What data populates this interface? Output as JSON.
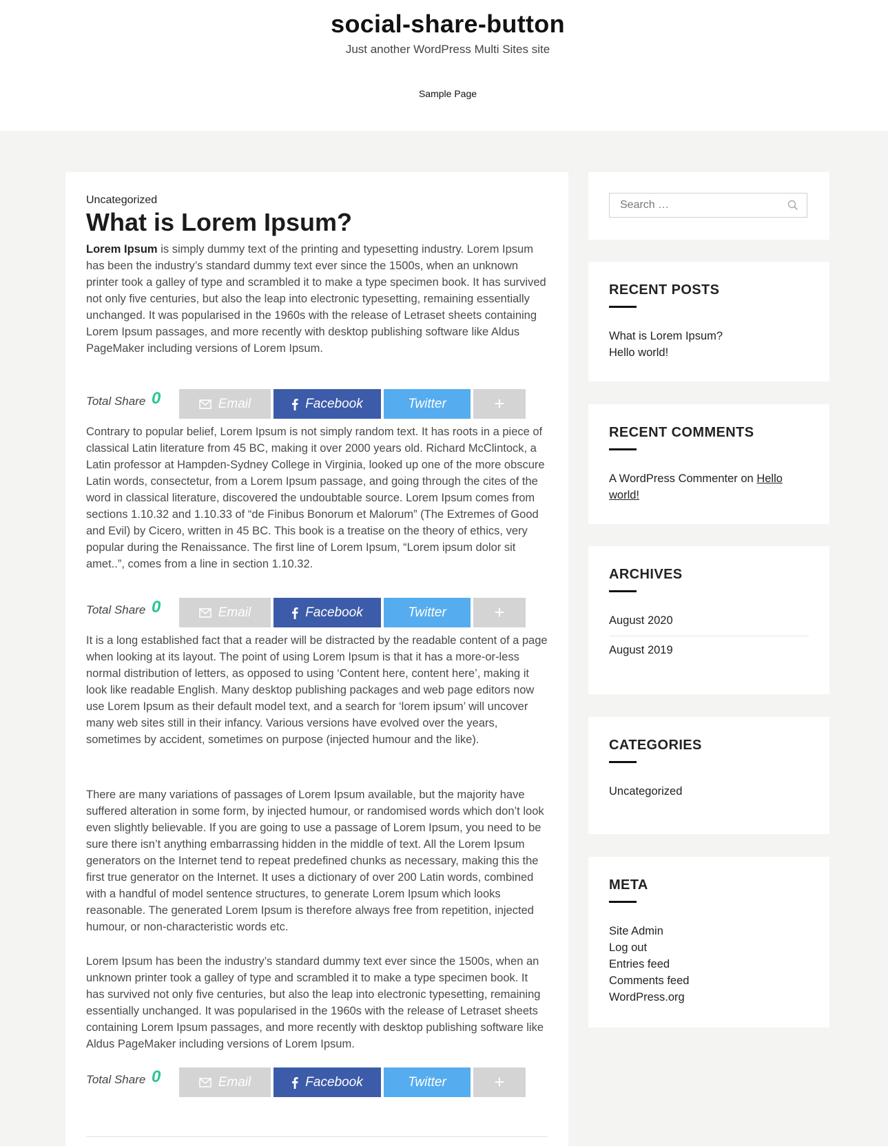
{
  "site": {
    "title": "social-share-button",
    "tagline": "Just another WordPress Multi Sites site",
    "nav": [
      "Sample Page"
    ]
  },
  "post": {
    "category": "Uncategorized",
    "title": "What is Lorem Ipsum?",
    "p1_lead": "Lorem Ipsum",
    "p1_rest": " is simply dummy text of the printing and typesetting industry. Lorem Ipsum has been the industry’s standard dummy text ever since the 1500s, when an unknown printer took a galley of type and scrambled it to make a type specimen book. It has survived not only five centuries, but also the leap into electronic typesetting, remaining essentially unchanged. It was popularised in the 1960s with the release of Letraset sheets containing Lorem Ipsum passages, and more recently with desktop publishing software like Aldus PageMaker including versions of Lorem Ipsum.",
    "p2": "Contrary to popular belief, Lorem Ipsum is not simply random text. It has roots in a piece of classical Latin literature from 45 BC, making it over 2000 years old. Richard McClintock, a Latin professor at Hampden-Sydney College in Virginia, looked up one of the more obscure Latin words, consectetur, from a Lorem Ipsum passage, and going through the cites of the word in classical literature, discovered the undoubtable source. Lorem Ipsum comes from sections 1.10.32 and 1.10.33 of “de Finibus Bonorum et Malorum” (The Extremes of Good and Evil) by Cicero, written in 45 BC. This book is a treatise on the theory of ethics, very popular during the Renaissance. The first line of Lorem Ipsum, “Lorem ipsum dolor sit amet..”, comes from a line in section 1.10.32.",
    "p3": "It is a long established fact that a reader will be distracted by the readable content of a page when looking at its layout. The point of using Lorem Ipsum is that it has a more-or-less normal distribution of letters, as opposed to using ‘Content here, content here’, making it look like readable English. Many desktop publishing packages and web page editors now use Lorem Ipsum as their default model text, and a search for ‘lorem ipsum’ will uncover many web sites still in their infancy. Various versions have evolved over the years, sometimes by accident, sometimes on purpose (injected humour and the like).",
    "p4": "There are many variations of passages of Lorem Ipsum available, but the majority have suffered alteration in some form, by injected humour, or randomised words which don’t look even slightly believable. If you are going to use a passage of Lorem Ipsum, you need to be sure there isn’t anything embarrassing hidden in the middle of text. All the Lorem Ipsum generators on the Internet tend to repeat predefined chunks as necessary, making this the first true generator on the Internet. It uses a dictionary of over 200 Latin words, combined with a handful of model sentence structures, to generate Lorem Ipsum which looks reasonable. The generated Lorem Ipsum is therefore always free from repetition, injected humour, or non-characteristic words etc.",
    "p5": "Lorem Ipsum has been the industry’s standard dummy text ever since the 1500s, when an unknown printer took a galley of type and scrambled it to make a type specimen book. It has survived not only five centuries, but also the leap into electronic typesetting, remaining essentially unchanged. It was popularised in the 1960s with the release of Letraset sheets containing Lorem Ipsum passages, and more recently with desktop publishing software like Aldus PageMaker including versions of Lorem Ipsum."
  },
  "share": {
    "label": "Total Share",
    "count": "0",
    "email": "Email",
    "facebook": "Facebook",
    "twitter": "Twitter",
    "more": "+",
    "colors": {
      "email": "#d4d4d4",
      "facebook": "#3c5ba9",
      "twitter": "#55acee",
      "count": "#2bc58f"
    }
  },
  "sidebar": {
    "search_placeholder": "Search …",
    "recent_posts": {
      "title": "RECENT POSTS",
      "items": [
        "What is Lorem Ipsum?",
        "Hello world!"
      ]
    },
    "recent_comments": {
      "title": "RECENT COMMENTS",
      "author": "A WordPress Commenter",
      "on": "on",
      "post_link": "Hello world!"
    },
    "archives": {
      "title": "ARCHIVES",
      "items": [
        "August 2020",
        "August 2019"
      ]
    },
    "categories": {
      "title": "CATEGORIES",
      "items": [
        "Uncategorized"
      ]
    },
    "meta": {
      "title": "META",
      "items": [
        "Site Admin",
        "Log out",
        "Entries feed",
        "Comments feed",
        "WordPress.org"
      ]
    }
  }
}
